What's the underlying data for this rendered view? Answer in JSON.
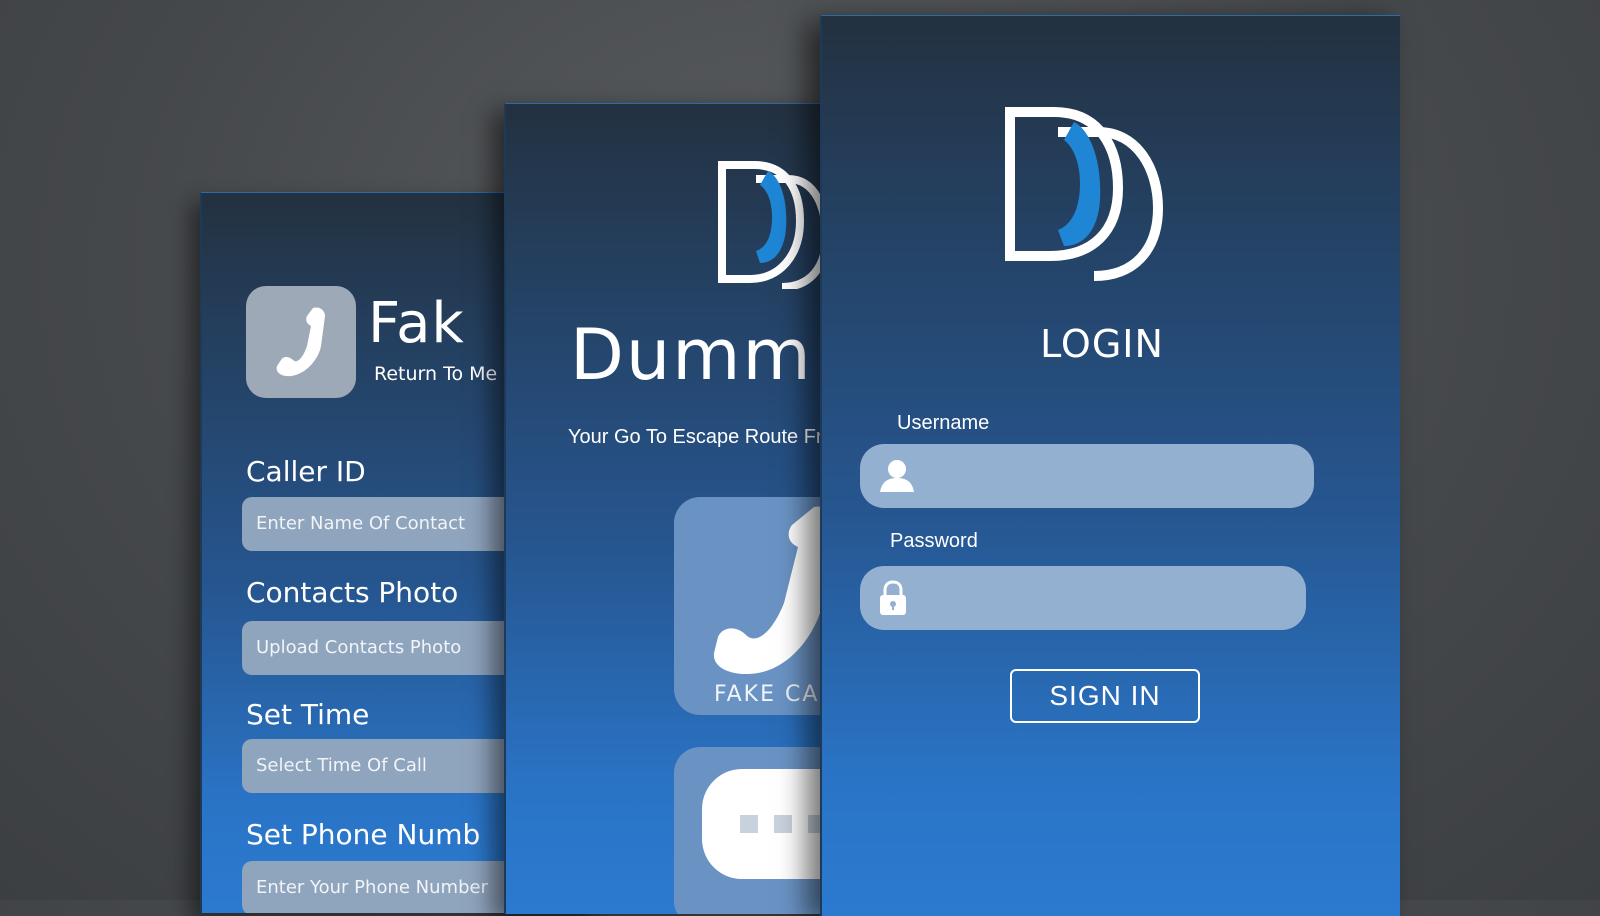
{
  "fake_call_screen": {
    "title": "Fak",
    "subtitle": "Return To Me",
    "fields": [
      {
        "label": "Caller ID",
        "placeholder": "Enter Name Of Contact"
      },
      {
        "label": "Contacts Photo",
        "placeholder": "Upload Contacts Photo"
      },
      {
        "label": "Set Time",
        "placeholder": "Select Time Of Call"
      },
      {
        "label": "Set Phone Numb",
        "placeholder": "Enter Your Phone Number"
      }
    ]
  },
  "home_screen": {
    "title": "Dumm",
    "tagline": "Your Go To Escape Route From",
    "tiles": [
      {
        "label": "FAKE CAL",
        "icon": "phone-icon"
      },
      {
        "label": "",
        "icon": "message-icon"
      }
    ]
  },
  "login_screen": {
    "title": "LOGIN",
    "username_label": "Username",
    "password_label": "Password",
    "signin_label": "SIGN IN",
    "icons": {
      "user": "user-icon",
      "lock": "lock-icon",
      "logo": "dd-logo"
    }
  },
  "colors": {
    "accent": "#1f86d6",
    "field": "#94b0d0",
    "screen_top": "#233140",
    "screen_bottom": "#2b7ad0"
  }
}
